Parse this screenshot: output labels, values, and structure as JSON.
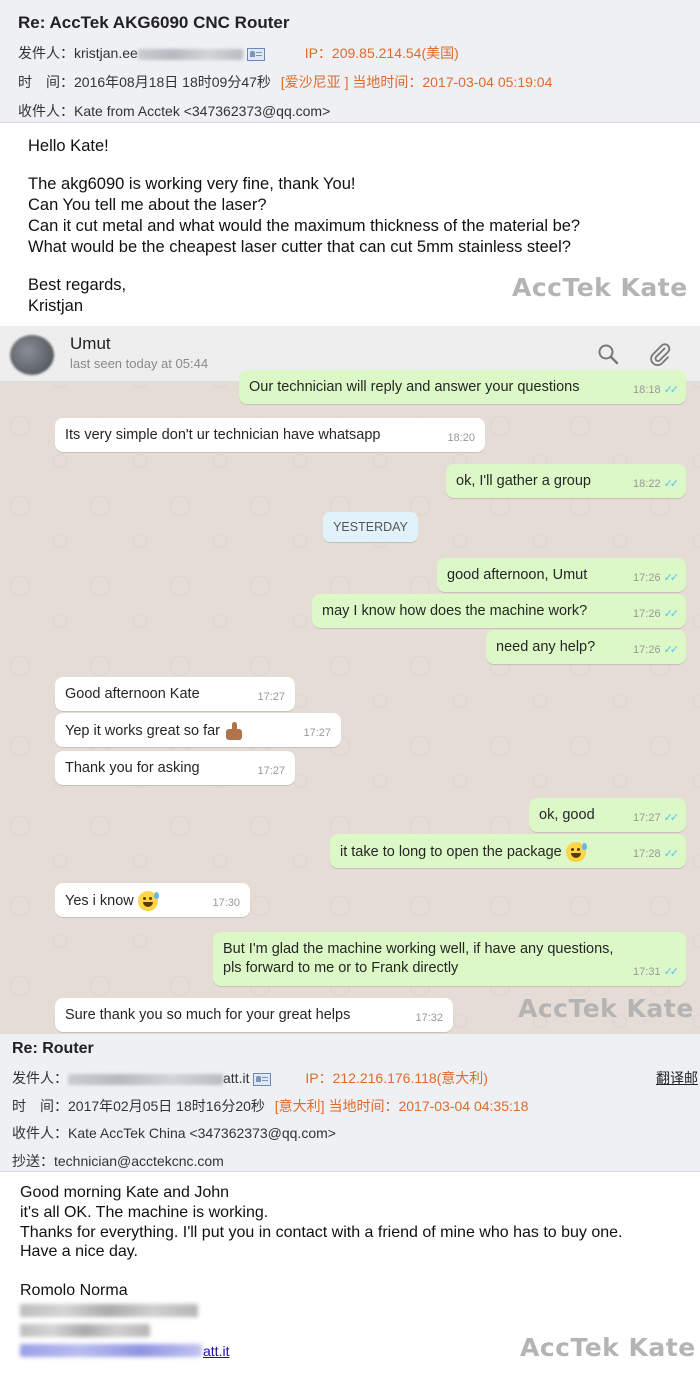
{
  "mail1": {
    "subject": "Re: AccTek AKG6090 CNC Router",
    "from_label": "发件人：",
    "from_value": "kristjan.ee",
    "ip_text": "IP：209.85.214.54(美国)",
    "time_label": "时　间：",
    "time_value": "2016年08月18日 18时09分47秒",
    "location_text": "[爱沙尼亚 ] 当地时间：2017-03-04 05:19:04",
    "to_label": "收件人：",
    "to_value": "Kate from Acctek <347362373@qq.com>",
    "body": {
      "greeting": "Hello Kate!",
      "line1": "The akg6090 is working very fine, thank You!",
      "line2": "Can You tell me about the laser?",
      "line3": "Can it cut metal and what would the maximum thickness of the material be?",
      "line4": "What would be the cheapest laser cutter that can cut 5mm stainless steel?",
      "closing": "Best regards,",
      "signature": "Kristjan"
    },
    "watermark": "AccTek Kate"
  },
  "whatsapp": {
    "contact_name": "Umut",
    "last_seen": "last seen today at 05:44",
    "icons": [
      "search-icon",
      "paperclip-icon"
    ],
    "date_chip": "YESTERDAY",
    "messages": [
      {
        "dir": "out",
        "text": "Our technician will reply and answer your questions",
        "time": "18:18"
      },
      {
        "dir": "in",
        "text": "Its very simple don't ur technician have whatsapp",
        "time": "18:20"
      },
      {
        "dir": "out",
        "text": "ok, I'll gather a group",
        "time": "18:22"
      },
      {
        "dir": "out",
        "text": "good afternoon, Umut",
        "time": "17:26"
      },
      {
        "dir": "out",
        "text": "may I know how does the machine work?",
        "time": "17:26"
      },
      {
        "dir": "out",
        "text": "need any help?",
        "time": "17:26"
      },
      {
        "dir": "in",
        "text": "Good afternoon Kate",
        "time": "17:27"
      },
      {
        "dir": "in",
        "text": "Yep it works great so far",
        "time": "17:27"
      },
      {
        "dir": "in",
        "text": "Thank you for asking",
        "time": "17:27"
      },
      {
        "dir": "out",
        "text": "ok, good",
        "time": "17:27"
      },
      {
        "dir": "out",
        "text": "it take to long to open the package",
        "time": "17:28"
      },
      {
        "dir": "in",
        "text": "Yes i know",
        "time": "17:30"
      },
      {
        "dir": "out",
        "text": "But I'm glad the machine working well, if have any questions, pls forward to me or to Frank directly",
        "time": "17:31"
      },
      {
        "dir": "in",
        "text": "Sure thank you so much for your great helps",
        "time": "17:32"
      }
    ],
    "tick": "✓✓",
    "watermark": "AccTek Kate"
  },
  "mail2": {
    "subject": "Re: Router",
    "from_label": "发件人：",
    "from_value": "att.it",
    "ip_text": "IP：212.216.176.118(意大利)",
    "translate_label": "翻译邮",
    "time_label": "时　间：",
    "time_value": "2017年02月05日 18时16分20秒",
    "location_text": "[意大利] 当地时间：2017-03-04 04:35:18",
    "to_label": "收件人：",
    "to_value": "Kate AccTek China <347362373@qq.com>",
    "cc_label": "抄送：",
    "cc_value": "technician@acctekcnc.com",
    "body": {
      "line1": "Good morning Kate and John",
      "line2": "it's all OK. The machine is working.",
      "line3": "Thanks for everything. I'll put you in contact with a friend of mine who has to buy one.",
      "line4": "Have a nice day.",
      "signature": "Romolo Norma",
      "link_tail": "att.it"
    },
    "watermark": "AccTek Kate"
  }
}
